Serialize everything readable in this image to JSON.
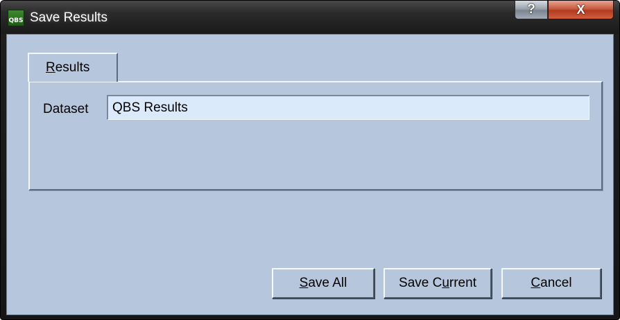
{
  "window": {
    "title": "Save Results",
    "app_icon_text": "QBS",
    "help_glyph": "?",
    "close_glyph": "X"
  },
  "tabs": [
    {
      "label": "Results",
      "selected": true
    }
  ],
  "form": {
    "dataset_label": "Dataset",
    "dataset_value": "QBS Results"
  },
  "buttons": {
    "save_all": {
      "label": "Save All",
      "mnemonic": "S"
    },
    "save_current": {
      "label": "Save Current",
      "mnemonic": "u"
    },
    "cancel": {
      "label": "Cancel",
      "mnemonic": "C"
    }
  },
  "icons": {
    "app": "qbs-app-icon",
    "help": "help-icon",
    "close": "close-icon"
  },
  "colors": {
    "client_background": "#b6c6dc",
    "input_background": "#dbeafa",
    "close_button": "#c85a3f"
  }
}
